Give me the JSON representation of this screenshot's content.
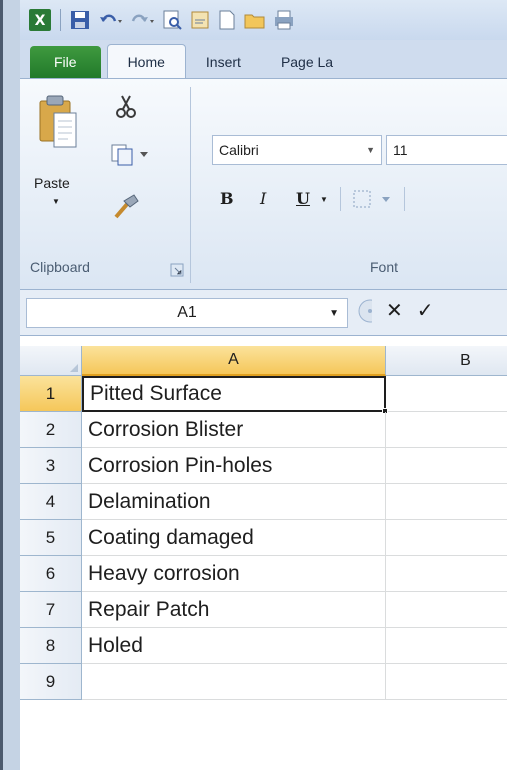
{
  "tabs": [
    {
      "label": "File"
    },
    {
      "label": "Home"
    },
    {
      "label": "Insert"
    },
    {
      "label": "Page La"
    }
  ],
  "ribbon": {
    "paste_label": "Paste",
    "clipboard_label": "Clipboard",
    "font_label": "Font",
    "font_name": "Calibri",
    "font_size": "11",
    "bold": "B",
    "italic": "I",
    "underline": "U"
  },
  "formula_bar": {
    "name_box": "A1",
    "cancel": "✕",
    "enter": "✓"
  },
  "columns": [
    "A",
    "B"
  ],
  "rows": [
    {
      "num": "1",
      "a": "Pitted Surface"
    },
    {
      "num": "2",
      "a": "Corrosion Blister"
    },
    {
      "num": "3",
      "a": "Corrosion Pin-holes"
    },
    {
      "num": "4",
      "a": "Delamination"
    },
    {
      "num": "5",
      "a": "Coating damaged"
    },
    {
      "num": "6",
      "a": "Heavy corrosion"
    },
    {
      "num": "7",
      "a": "Repair Patch"
    },
    {
      "num": "8",
      "a": "Holed"
    },
    {
      "num": "9",
      "a": ""
    }
  ],
  "colors": {
    "file_tab": "#217a2a",
    "selection_header": "#f5c75a"
  }
}
